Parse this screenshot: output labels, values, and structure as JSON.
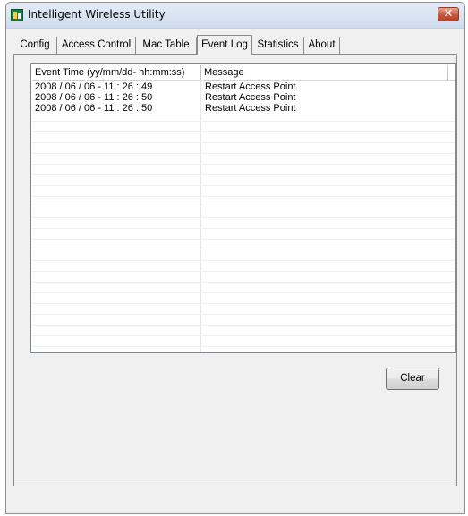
{
  "window": {
    "title": "Intelligent Wireless Utility",
    "close_glyph": "✕"
  },
  "tabs": [
    {
      "label": "Config",
      "active": false
    },
    {
      "label": "Access Control",
      "active": false
    },
    {
      "label": "Mac Table",
      "active": false
    },
    {
      "label": "Event Log",
      "active": true
    },
    {
      "label": "Statistics",
      "active": false
    },
    {
      "label": "About",
      "active": false
    }
  ],
  "event_log": {
    "columns": [
      "Event Time (yy/mm/dd- hh:mm:ss)",
      "Message"
    ],
    "rows": [
      {
        "time": "2008 / 06 / 06 - 11 : 26 : 49",
        "message": "Restart Access Point"
      },
      {
        "time": "2008 / 06 / 06 - 11 : 26 : 50",
        "message": "Restart Access Point"
      },
      {
        "time": "2008 / 06 / 06 - 11 : 26 : 50",
        "message": "Restart Access Point"
      }
    ],
    "clear_label": "Clear"
  },
  "icons": {
    "app": "wireless-utility-icon",
    "close": "close-icon"
  },
  "colors": {
    "window_bg": "#f0f0f0",
    "title_bg": "#d8e3f1",
    "close_red": "#c7553c",
    "list_bg": "#ffffff"
  }
}
